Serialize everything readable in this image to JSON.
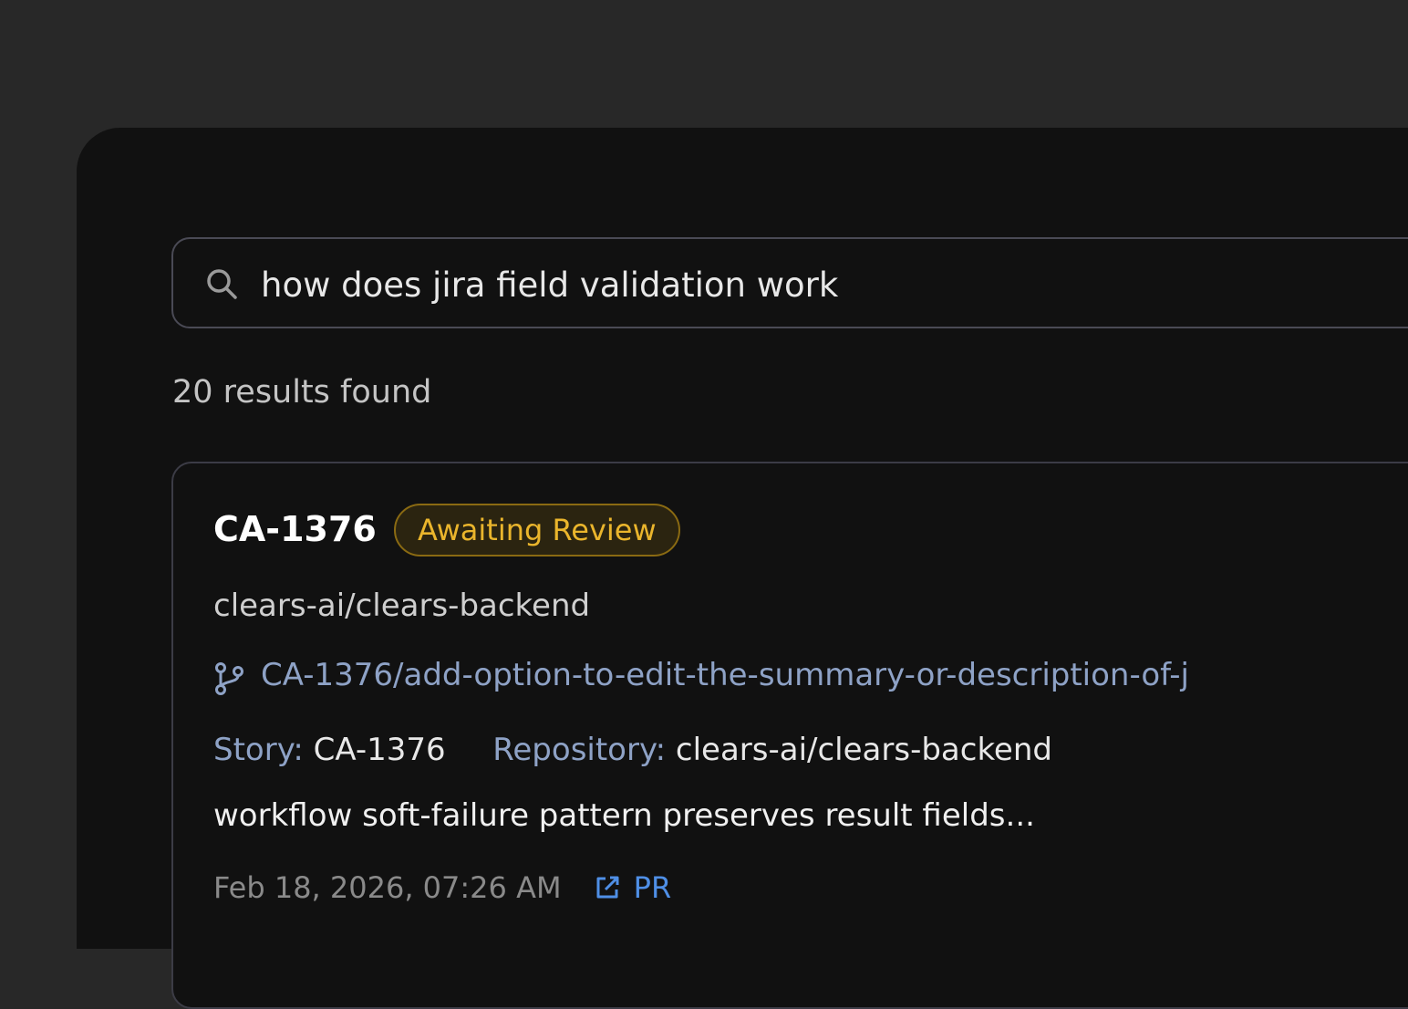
{
  "search": {
    "query": "how does jira field validation work",
    "icon": "search-icon"
  },
  "results": {
    "count_text": "20 results found"
  },
  "card": {
    "id": "CA-1376",
    "status": "Awaiting Review",
    "status_color": "#eab52c",
    "repo": "clears-ai/clears-backend",
    "branch_icon": "git-branch-icon",
    "branch": "CA-1376/add-option-to-edit-the-summary-or-description-of-j",
    "story_label": "Story:",
    "story_value": "CA-1376",
    "repository_label": "Repository:",
    "repository_value": "clears-ai/clears-backend",
    "snippet": "workflow soft-failure pattern preserves result fields...",
    "timestamp": "Feb 18, 2026, 07:26 AM",
    "pr_icon": "external-link-icon",
    "pr_label": "PR"
  },
  "colors": {
    "background": "#282828",
    "panel": "#111111",
    "accent_link": "#4f8fe6",
    "label_blue": "#8ea2c6"
  }
}
